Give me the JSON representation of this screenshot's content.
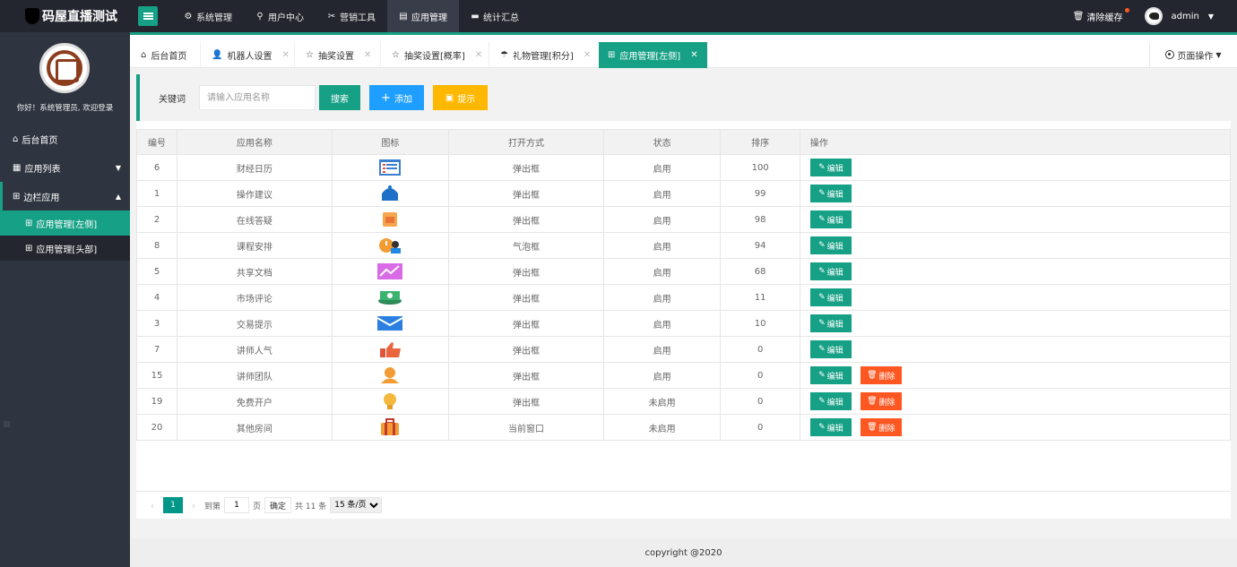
{
  "app": {
    "brand": "码屋直播测试"
  },
  "nav": {
    "items": [
      {
        "label": "系统管理",
        "icon": "gear-icon"
      },
      {
        "label": "用户中心",
        "icon": "user-icon"
      },
      {
        "label": "营销工具",
        "icon": "tools-icon"
      },
      {
        "label": "应用管理",
        "icon": "app-icon"
      },
      {
        "label": "统计汇总",
        "icon": "chat-icon"
      }
    ],
    "clear_cache": "清除缓存",
    "user": "admin"
  },
  "sidebar": {
    "welcome": "你好！系统管理员, 欢迎登录",
    "items": [
      {
        "label": "后台首页"
      },
      {
        "label": "应用列表"
      },
      {
        "label": "边栏应用"
      }
    ],
    "subitems": [
      {
        "label": "应用管理[左侧]"
      },
      {
        "label": "应用管理[头部]"
      }
    ]
  },
  "tabs": [
    {
      "label": "后台首页"
    },
    {
      "label": "机器人设置"
    },
    {
      "label": "抽奖设置"
    },
    {
      "label": "抽奖设置[概率]"
    },
    {
      "label": "礼物管理[积分]"
    },
    {
      "label": "应用管理[左侧]"
    }
  ],
  "page_ops": "页面操作",
  "search": {
    "label": "关键词",
    "placeholder": "请输入应用名称",
    "search_btn": "搜索",
    "add_btn": "添加",
    "tip_btn": "提示"
  },
  "table": {
    "headers": [
      "编号",
      "应用名称",
      "图标",
      "打开方式",
      "状态",
      "排序",
      "操作"
    ],
    "edit_label": "编辑",
    "delete_label": "删除",
    "rows": [
      {
        "id": "6",
        "name": "财经日历",
        "icon": "calendar-list-icon",
        "open": "弹出框",
        "status": "启用",
        "sort": "100",
        "deletable": false
      },
      {
        "id": "1",
        "name": "操作建议",
        "icon": "bell-icon",
        "open": "弹出框",
        "status": "启用",
        "sort": "99",
        "deletable": false
      },
      {
        "id": "2",
        "name": "在线答疑",
        "icon": "chat-doc-icon",
        "open": "弹出框",
        "status": "启用",
        "sort": "98",
        "deletable": false
      },
      {
        "id": "8",
        "name": "课程安排",
        "icon": "teacher-clock-icon",
        "open": "气泡框",
        "status": "启用",
        "sort": "94",
        "deletable": false
      },
      {
        "id": "5",
        "name": "共享文档",
        "icon": "chart-image-icon",
        "open": "弹出框",
        "status": "启用",
        "sort": "68",
        "deletable": false
      },
      {
        "id": "4",
        "name": "市场评论",
        "icon": "money-stack-icon",
        "open": "弹出框",
        "status": "启用",
        "sort": "11",
        "deletable": false
      },
      {
        "id": "3",
        "name": "交易提示",
        "icon": "envelope-icon",
        "open": "弹出框",
        "status": "启用",
        "sort": "10",
        "deletable": false
      },
      {
        "id": "7",
        "name": "讲师人气",
        "icon": "thumbs-up-icon",
        "open": "弹出框",
        "status": "启用",
        "sort": "0",
        "deletable": false
      },
      {
        "id": "15",
        "name": "讲师团队",
        "icon": "person-icon",
        "open": "弹出框",
        "status": "启用",
        "sort": "0",
        "deletable": true
      },
      {
        "id": "19",
        "name": "免费开户",
        "icon": "lightbulb-icon",
        "open": "弹出框",
        "status": "未启用",
        "sort": "0",
        "deletable": true
      },
      {
        "id": "20",
        "name": "其他房间",
        "icon": "suitcase-icon",
        "open": "当前窗口",
        "status": "未启用",
        "sort": "0",
        "deletable": true
      }
    ]
  },
  "pager": {
    "current": "1",
    "goto_label": "到第",
    "goto_value": "1",
    "page_unit": "页",
    "confirm": "确定",
    "total": "共 11 条",
    "page_size": "15 条/页"
  },
  "footer": "copyright @2020",
  "colors": {
    "primary": "#16a085",
    "blue": "#1e9fff",
    "orange": "#ffb800",
    "danger": "#ff5722",
    "dark": "#23262e"
  }
}
